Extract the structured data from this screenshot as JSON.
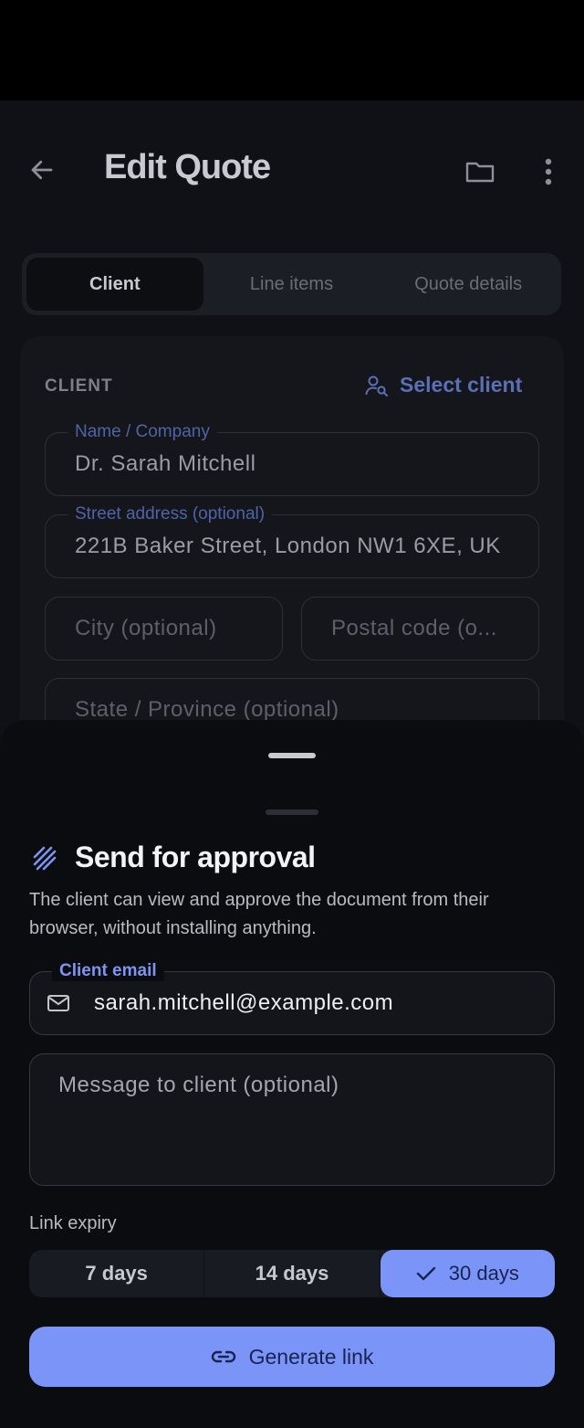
{
  "header": {
    "title": "Edit Quote",
    "icons": {
      "back": "arrow-left-icon",
      "folder": "folder-icon",
      "more": "more-vertical-icon"
    }
  },
  "tabs": [
    {
      "label": "Client",
      "active": true
    },
    {
      "label": "Line items",
      "active": false
    },
    {
      "label": "Quote details",
      "active": false
    }
  ],
  "client_section": {
    "label": "CLIENT",
    "select_client_label": "Select client",
    "fields": {
      "name": {
        "label": "Name / Company",
        "value": "Dr. Sarah Mitchell"
      },
      "street": {
        "label": "Street address (optional)",
        "value": "221B Baker Street, London NW1 6XE, UK"
      },
      "city": {
        "placeholder": "City (optional)"
      },
      "postal": {
        "placeholder": "Postal code (o..."
      },
      "state": {
        "placeholder": "State / Province (optional)"
      }
    }
  },
  "approval_sheet": {
    "title": "Send for approval",
    "description": "The client can view and approve the document from their browser, without installing anything.",
    "email": {
      "label": "Client email",
      "value": "sarah.mitchell@example.com"
    },
    "message": {
      "placeholder": "Message to client (optional)"
    },
    "expiry": {
      "label": "Link expiry",
      "options": [
        {
          "label": "7 days",
          "selected": false
        },
        {
          "label": "14 days",
          "selected": false
        },
        {
          "label": "30 days",
          "selected": true
        }
      ]
    },
    "generate_label": "Generate link"
  },
  "colors": {
    "accent": "#7a95f7",
    "accent_text": "#1a2250",
    "background": "#101117",
    "sheet": "#0b0c10"
  }
}
